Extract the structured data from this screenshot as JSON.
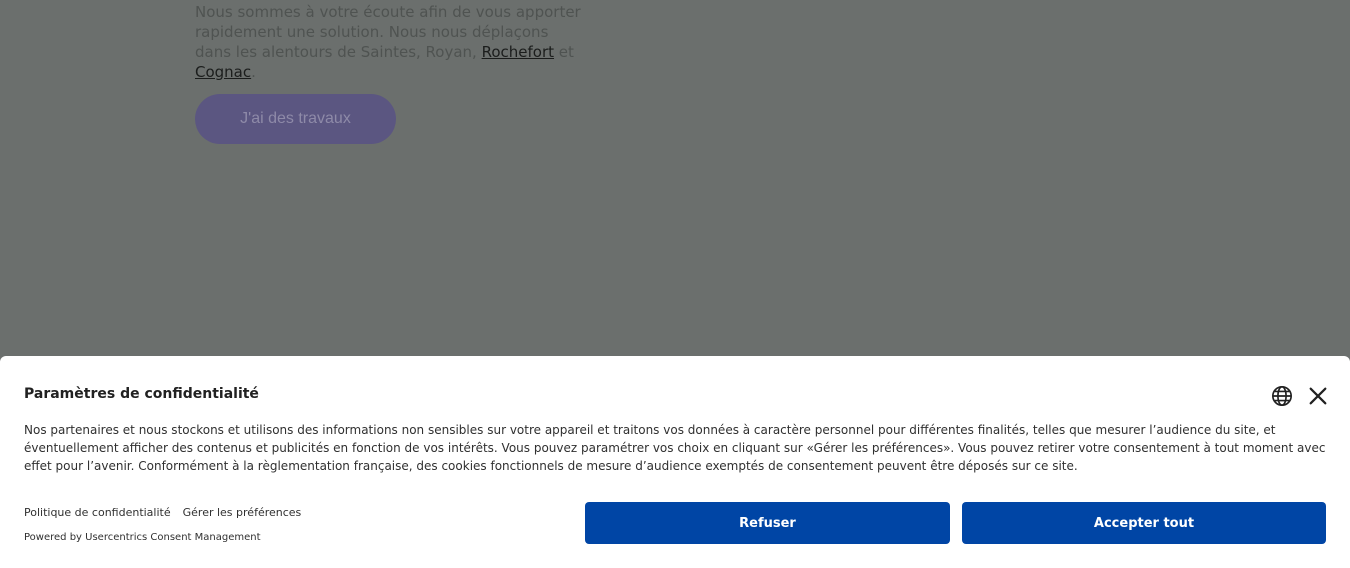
{
  "background": {
    "paragraph_part1": "Nous sommes à votre écoute afin de vous apporter rapidement une solution. Nous nous déplaçons dans les alentours de Saintes, Royan, ",
    "link_rochefort": "Rochefort",
    "paragraph_part2": " et ",
    "link_cognac": "Cognac",
    "paragraph_end": ".",
    "cta_label": "J'ai des travaux"
  },
  "banner": {
    "title": "Paramètres de confidentialité",
    "description": "Nos partenaires et nous stockons et utilisons des informations non sensibles sur votre appareil et traitons vos données à caractère personnel pour différentes finalités, telles que mesurer l’audience du site, et éventuellement afficher des contenus et publicités en fonction de vos intérêts. Vous pouvez paramétrer vos choix en cliquant sur «Gérer les préférences». Vous pouvez retirer votre consentement à tout moment avec effet pour l’avenir. Conformément à la règlementation française, des cookies fonctionnels de mesure d’audience exemptés de consentement peuvent être déposés sur ce site.",
    "privacy_link": "Politique de confidentialité",
    "preferences_link": "Gérer les préférences",
    "powered_by": "Powered by Usercentrics Consent Management",
    "refuse_label": "Refuser",
    "accept_label": "Accepter tout",
    "icons": {
      "language": "globe-icon",
      "close": "close-icon"
    },
    "colors": {
      "button": "#0045a5",
      "overlay": "#6b6f6d"
    }
  }
}
